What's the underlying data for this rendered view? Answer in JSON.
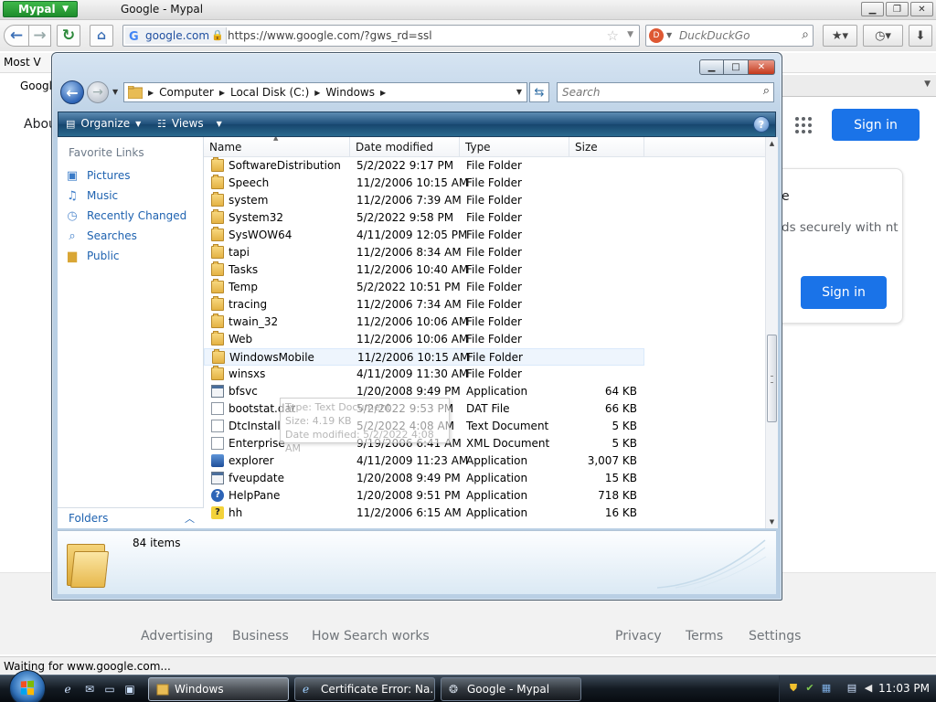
{
  "browser": {
    "app_button": "Mypal",
    "title": "Google - Mypal",
    "url_site": "google.com",
    "url": "https://www.google.com/?gws_rd=ssl",
    "search_placeholder": "DuckDuckGo",
    "bookmark": "Most V",
    "tab": "Googl",
    "status": "Waiting for www.google.com..."
  },
  "google": {
    "about": "Abou",
    "signin_top": "Sign in",
    "card_title": "e",
    "card_text": "ds securely with nt",
    "signin_card": "Sign in",
    "footer_links": [
      "Advertising",
      "Business",
      "How Search works",
      "Privacy",
      "Terms",
      "Settings"
    ]
  },
  "explorer": {
    "breadcrumbs": [
      "Computer",
      "Local Disk (C:)",
      "Windows"
    ],
    "search_placeholder": "Search",
    "commands": {
      "organize": "Organize",
      "views": "Views"
    },
    "favorite_title": "Favorite Links",
    "favorites": [
      {
        "label": "Pictures",
        "icon": "pictures-icon"
      },
      {
        "label": "Music",
        "icon": "music-icon"
      },
      {
        "label": "Recently Changed",
        "icon": "recently-changed-icon"
      },
      {
        "label": "Searches",
        "icon": "searches-icon"
      },
      {
        "label": "Public",
        "icon": "public-folder-icon"
      }
    ],
    "folders_label": "Folders",
    "columns": [
      "Name",
      "Date modified",
      "Type",
      "Size"
    ],
    "files": [
      {
        "name": "SoftwareDistribution",
        "date": "5/2/2022 9:17 PM",
        "type": "File Folder",
        "size": "",
        "icon": "folder"
      },
      {
        "name": "Speech",
        "date": "11/2/2006 10:15 AM",
        "type": "File Folder",
        "size": "",
        "icon": "folder"
      },
      {
        "name": "system",
        "date": "11/2/2006 7:39 AM",
        "type": "File Folder",
        "size": "",
        "icon": "folder"
      },
      {
        "name": "System32",
        "date": "5/2/2022 9:58 PM",
        "type": "File Folder",
        "size": "",
        "icon": "folder"
      },
      {
        "name": "SysWOW64",
        "date": "4/11/2009 12:05 PM",
        "type": "File Folder",
        "size": "",
        "icon": "folder"
      },
      {
        "name": "tapi",
        "date": "11/2/2006 8:34 AM",
        "type": "File Folder",
        "size": "",
        "icon": "folder"
      },
      {
        "name": "Tasks",
        "date": "11/2/2006 10:40 AM",
        "type": "File Folder",
        "size": "",
        "icon": "folder"
      },
      {
        "name": "Temp",
        "date": "5/2/2022 10:51 PM",
        "type": "File Folder",
        "size": "",
        "icon": "folder"
      },
      {
        "name": "tracing",
        "date": "11/2/2006 7:34 AM",
        "type": "File Folder",
        "size": "",
        "icon": "folder"
      },
      {
        "name": "twain_32",
        "date": "11/2/2006 10:06 AM",
        "type": "File Folder",
        "size": "",
        "icon": "folder"
      },
      {
        "name": "Web",
        "date": "11/2/2006 10:06 AM",
        "type": "File Folder",
        "size": "",
        "icon": "folder"
      },
      {
        "name": "WindowsMobile",
        "date": "11/2/2006 10:15 AM",
        "type": "File Folder",
        "size": "",
        "icon": "folder"
      },
      {
        "name": "winsxs",
        "date": "4/11/2009 11:30 AM",
        "type": "File Folder",
        "size": "",
        "icon": "folder"
      },
      {
        "name": "bfsvc",
        "date": "1/20/2008 9:49 PM",
        "type": "Application",
        "size": "64 KB",
        "icon": "app"
      },
      {
        "name": "bootstat.dat",
        "date": "5/2/2022 9:53 PM",
        "type": "DAT File",
        "size": "66 KB",
        "icon": "doc"
      },
      {
        "name": "DtcInstall",
        "date": "5/2/2022 4:08 AM",
        "type": "Text Document",
        "size": "5 KB",
        "icon": "doc"
      },
      {
        "name": "Enterprise",
        "date": "9/19/2006 6:41 AM",
        "type": "XML Document",
        "size": "5 KB",
        "icon": "doc"
      },
      {
        "name": "explorer",
        "date": "4/11/2009 11:23 AM",
        "type": "Application",
        "size": "3,007 KB",
        "icon": "explorer"
      },
      {
        "name": "fveupdate",
        "date": "1/20/2008 9:49 PM",
        "type": "Application",
        "size": "15 KB",
        "icon": "app"
      },
      {
        "name": "HelpPane",
        "date": "1/20/2008 9:51 PM",
        "type": "Application",
        "size": "718 KB",
        "icon": "help"
      },
      {
        "name": "hh",
        "date": "11/2/2006 6:15 AM",
        "type": "Application",
        "size": "16 KB",
        "icon": "hh"
      }
    ],
    "tooltip": [
      "Type: Text Document",
      "Size: 4.19 KB",
      "Date modified: 5/2/2022 4:08 AM"
    ],
    "item_count": "84 items"
  },
  "taskbar": {
    "tasks": [
      "Windows",
      "Certificate Error: Na...",
      "Google - Mypal"
    ],
    "clock": "11:03 PM"
  },
  "colors": {
    "accent": "#1a73e8",
    "link": "#1e62b0",
    "taskbar": "#131a22"
  }
}
